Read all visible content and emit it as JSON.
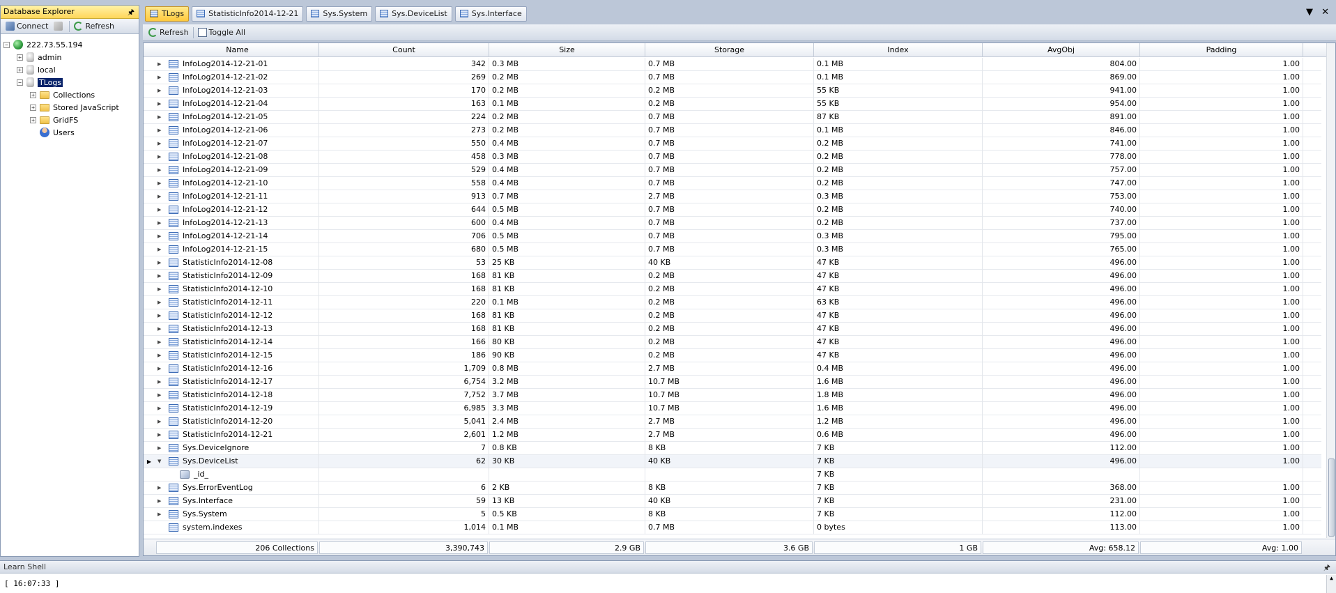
{
  "explorer": {
    "title": "Database Explorer",
    "pin_glyph": "🖈",
    "toolbar": {
      "connect_label": "Connect",
      "refresh_label": "Refresh"
    },
    "tree": [
      {
        "label": "222.73.55.194",
        "icon": "globe-icon",
        "level": 0,
        "expander": "−"
      },
      {
        "label": "admin",
        "icon": "database-icon",
        "level": 1,
        "expander": "+"
      },
      {
        "label": "local",
        "icon": "database-icon",
        "level": 1,
        "expander": "+"
      },
      {
        "label": "TLogs",
        "icon": "database-icon",
        "level": 1,
        "expander": "−",
        "selected": true
      },
      {
        "label": "Collections",
        "icon": "folder-icon",
        "level": 2,
        "expander": "+"
      },
      {
        "label": "Stored JavaScript",
        "icon": "folder-icon",
        "level": 2,
        "expander": "+"
      },
      {
        "label": "GridFS",
        "icon": "folder-icon",
        "level": 2,
        "expander": "+"
      },
      {
        "label": "Users",
        "icon": "user-icon",
        "level": 2,
        "expander": ""
      }
    ]
  },
  "tabs": [
    {
      "label": "TLogs",
      "active": true
    },
    {
      "label": "StatisticInfo2014-12-21",
      "active": false
    },
    {
      "label": "Sys.System",
      "active": false
    },
    {
      "label": "Sys.DeviceList",
      "active": false
    },
    {
      "label": "Sys.Interface",
      "active": false
    }
  ],
  "tab_controls": "▼ ✕",
  "grid_toolbar": {
    "refresh_label": "Refresh",
    "toggle_all_label": "Toggle All"
  },
  "columns": [
    "Name",
    "Count",
    "Size",
    "Storage",
    "Index",
    "AvgObj",
    "Padding"
  ],
  "rows": [
    {
      "name": "InfoLog2014-12-21-01",
      "count": "342",
      "size": "0.3 MB",
      "storage": "0.7 MB",
      "index": "0.1 MB",
      "avgobj": "804.00",
      "padding": "1.00"
    },
    {
      "name": "InfoLog2014-12-21-02",
      "count": "269",
      "size": "0.2 MB",
      "storage": "0.7 MB",
      "index": "0.1 MB",
      "avgobj": "869.00",
      "padding": "1.00"
    },
    {
      "name": "InfoLog2014-12-21-03",
      "count": "170",
      "size": "0.2 MB",
      "storage": "0.2 MB",
      "index": "55 KB",
      "avgobj": "941.00",
      "padding": "1.00"
    },
    {
      "name": "InfoLog2014-12-21-04",
      "count": "163",
      "size": "0.1 MB",
      "storage": "0.2 MB",
      "index": "55 KB",
      "avgobj": "954.00",
      "padding": "1.00"
    },
    {
      "name": "InfoLog2014-12-21-05",
      "count": "224",
      "size": "0.2 MB",
      "storage": "0.7 MB",
      "index": "87 KB",
      "avgobj": "891.00",
      "padding": "1.00"
    },
    {
      "name": "InfoLog2014-12-21-06",
      "count": "273",
      "size": "0.2 MB",
      "storage": "0.7 MB",
      "index": "0.1 MB",
      "avgobj": "846.00",
      "padding": "1.00"
    },
    {
      "name": "InfoLog2014-12-21-07",
      "count": "550",
      "size": "0.4 MB",
      "storage": "0.7 MB",
      "index": "0.2 MB",
      "avgobj": "741.00",
      "padding": "1.00"
    },
    {
      "name": "InfoLog2014-12-21-08",
      "count": "458",
      "size": "0.3 MB",
      "storage": "0.7 MB",
      "index": "0.2 MB",
      "avgobj": "778.00",
      "padding": "1.00"
    },
    {
      "name": "InfoLog2014-12-21-09",
      "count": "529",
      "size": "0.4 MB",
      "storage": "0.7 MB",
      "index": "0.2 MB",
      "avgobj": "757.00",
      "padding": "1.00"
    },
    {
      "name": "InfoLog2014-12-21-10",
      "count": "558",
      "size": "0.4 MB",
      "storage": "0.7 MB",
      "index": "0.2 MB",
      "avgobj": "747.00",
      "padding": "1.00"
    },
    {
      "name": "InfoLog2014-12-21-11",
      "count": "913",
      "size": "0.7 MB",
      "storage": "2.7 MB",
      "index": "0.3 MB",
      "avgobj": "753.00",
      "padding": "1.00"
    },
    {
      "name": "InfoLog2014-12-21-12",
      "count": "644",
      "size": "0.5 MB",
      "storage": "0.7 MB",
      "index": "0.2 MB",
      "avgobj": "740.00",
      "padding": "1.00"
    },
    {
      "name": "InfoLog2014-12-21-13",
      "count": "600",
      "size": "0.4 MB",
      "storage": "0.7 MB",
      "index": "0.2 MB",
      "avgobj": "737.00",
      "padding": "1.00"
    },
    {
      "name": "InfoLog2014-12-21-14",
      "count": "706",
      "size": "0.5 MB",
      "storage": "0.7 MB",
      "index": "0.3 MB",
      "avgobj": "795.00",
      "padding": "1.00"
    },
    {
      "name": "InfoLog2014-12-21-15",
      "count": "680",
      "size": "0.5 MB",
      "storage": "0.7 MB",
      "index": "0.3 MB",
      "avgobj": "765.00",
      "padding": "1.00"
    },
    {
      "name": "StatisticInfo2014-12-08",
      "count": "53",
      "size": "25 KB",
      "storage": "40 KB",
      "index": "47 KB",
      "avgobj": "496.00",
      "padding": "1.00"
    },
    {
      "name": "StatisticInfo2014-12-09",
      "count": "168",
      "size": "81 KB",
      "storage": "0.2 MB",
      "index": "47 KB",
      "avgobj": "496.00",
      "padding": "1.00"
    },
    {
      "name": "StatisticInfo2014-12-10",
      "count": "168",
      "size": "81 KB",
      "storage": "0.2 MB",
      "index": "47 KB",
      "avgobj": "496.00",
      "padding": "1.00"
    },
    {
      "name": "StatisticInfo2014-12-11",
      "count": "220",
      "size": "0.1 MB",
      "storage": "0.2 MB",
      "index": "63 KB",
      "avgobj": "496.00",
      "padding": "1.00"
    },
    {
      "name": "StatisticInfo2014-12-12",
      "count": "168",
      "size": "81 KB",
      "storage": "0.2 MB",
      "index": "47 KB",
      "avgobj": "496.00",
      "padding": "1.00"
    },
    {
      "name": "StatisticInfo2014-12-13",
      "count": "168",
      "size": "81 KB",
      "storage": "0.2 MB",
      "index": "47 KB",
      "avgobj": "496.00",
      "padding": "1.00"
    },
    {
      "name": "StatisticInfo2014-12-14",
      "count": "166",
      "size": "80 KB",
      "storage": "0.2 MB",
      "index": "47 KB",
      "avgobj": "496.00",
      "padding": "1.00"
    },
    {
      "name": "StatisticInfo2014-12-15",
      "count": "186",
      "size": "90 KB",
      "storage": "0.2 MB",
      "index": "47 KB",
      "avgobj": "496.00",
      "padding": "1.00"
    },
    {
      "name": "StatisticInfo2014-12-16",
      "count": "1,709",
      "size": "0.8 MB",
      "storage": "2.7 MB",
      "index": "0.4 MB",
      "avgobj": "496.00",
      "padding": "1.00"
    },
    {
      "name": "StatisticInfo2014-12-17",
      "count": "6,754",
      "size": "3.2 MB",
      "storage": "10.7 MB",
      "index": "1.6 MB",
      "avgobj": "496.00",
      "padding": "1.00"
    },
    {
      "name": "StatisticInfo2014-12-18",
      "count": "7,752",
      "size": "3.7 MB",
      "storage": "10.7 MB",
      "index": "1.8 MB",
      "avgobj": "496.00",
      "padding": "1.00"
    },
    {
      "name": "StatisticInfo2014-12-19",
      "count": "6,985",
      "size": "3.3 MB",
      "storage": "10.7 MB",
      "index": "1.6 MB",
      "avgobj": "496.00",
      "padding": "1.00"
    },
    {
      "name": "StatisticInfo2014-12-20",
      "count": "5,041",
      "size": "2.4 MB",
      "storage": "2.7 MB",
      "index": "1.2 MB",
      "avgobj": "496.00",
      "padding": "1.00"
    },
    {
      "name": "StatisticInfo2014-12-21",
      "count": "2,601",
      "size": "1.2 MB",
      "storage": "2.7 MB",
      "index": "0.6 MB",
      "avgobj": "496.00",
      "padding": "1.00"
    },
    {
      "name": "Sys.DeviceIgnore",
      "count": "7",
      "size": "0.8 KB",
      "storage": "8 KB",
      "index": "7 KB",
      "avgobj": "112.00",
      "padding": "1.00"
    },
    {
      "name": "Sys.DeviceList",
      "count": "62",
      "size": "30 KB",
      "storage": "40 KB",
      "index": "7 KB",
      "avgobj": "496.00",
      "padding": "1.00",
      "expanded": true,
      "focused": true
    },
    {
      "name": "_id_",
      "count": "",
      "size": "",
      "storage": "",
      "index": "7 KB",
      "avgobj": "",
      "padding": "",
      "child": true
    },
    {
      "name": "Sys.ErrorEventLog",
      "count": "6",
      "size": "2 KB",
      "storage": "8 KB",
      "index": "7 KB",
      "avgobj": "368.00",
      "padding": "1.00"
    },
    {
      "name": "Sys.Interface",
      "count": "59",
      "size": "13 KB",
      "storage": "40 KB",
      "index": "7 KB",
      "avgobj": "231.00",
      "padding": "1.00"
    },
    {
      "name": "Sys.System",
      "count": "5",
      "size": "0.5 KB",
      "storage": "8 KB",
      "index": "7 KB",
      "avgobj": "112.00",
      "padding": "1.00"
    },
    {
      "name": "system.indexes",
      "count": "1,014",
      "size": "0.1 MB",
      "storage": "0.7 MB",
      "index": "0 bytes",
      "avgobj": "113.00",
      "padding": "1.00",
      "no_expander": true
    }
  ],
  "totals": {
    "name": "206 Collections",
    "count": "3,390,743",
    "size": "2.9 GB",
    "storage": "3.6 GB",
    "index": "1 GB",
    "avgobj": "Avg: 658.12",
    "padding": "Avg: 1.00"
  },
  "shell": {
    "title": "Learn Shell",
    "output": "[ 16:07:33 ]"
  },
  "colors": {
    "accent_tab": "#ffc93d",
    "selection": "#0a246a",
    "chrome_background": "#bcc7d8"
  }
}
